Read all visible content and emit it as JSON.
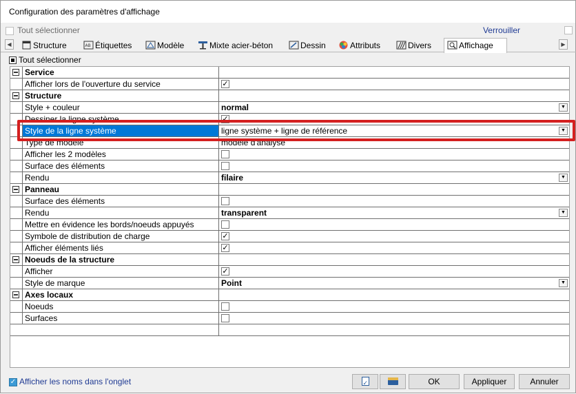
{
  "window": {
    "title": "Configuration des paramètres d'affichage"
  },
  "topbar": {
    "select_all": "Tout sélectionner",
    "lock": "Verrouiller"
  },
  "tabs": [
    {
      "label": "Structure",
      "icon": "structure-icon"
    },
    {
      "label": "Étiquettes",
      "icon": "labels-icon"
    },
    {
      "label": "Modèle",
      "icon": "model-icon"
    },
    {
      "label": "Mixte acier-béton",
      "icon": "composite-beam-icon"
    },
    {
      "label": "Dessin",
      "icon": "drawing-icon"
    },
    {
      "label": "Attributs",
      "icon": "attributes-icon"
    },
    {
      "label": "Divers",
      "icon": "misc-icon"
    },
    {
      "label": "Affichage",
      "icon": "display-icon"
    }
  ],
  "subbar": {
    "select_all": "Tout sélectionner"
  },
  "grid": {
    "rows": [
      {
        "type": "group",
        "label": "Service"
      },
      {
        "type": "check",
        "label": "Afficher lors de l'ouverture du service",
        "checked": true
      },
      {
        "type": "group",
        "label": "Structure"
      },
      {
        "type": "dropdown",
        "label": "Style + couleur",
        "value": "normal"
      },
      {
        "type": "check",
        "label": "Dessiner la ligne système",
        "checked": true
      },
      {
        "type": "dropdown",
        "label": "Style de la ligne système",
        "value": "ligne système + ligne de référence",
        "selected": true
      },
      {
        "type": "text",
        "label": "Type de modèle",
        "value": "modèle d'analyse"
      },
      {
        "type": "check",
        "label": "Afficher les 2 modèles",
        "checked": false
      },
      {
        "type": "check",
        "label": "Surface des éléments",
        "checked": false
      },
      {
        "type": "dropdown",
        "label": "Rendu",
        "value": "filaire"
      },
      {
        "type": "group",
        "label": "Panneau"
      },
      {
        "type": "check",
        "label": "Surface des éléments",
        "checked": false
      },
      {
        "type": "dropdown",
        "label": "Rendu",
        "value": "transparent"
      },
      {
        "type": "check",
        "label": "Mettre en évidence les bords/noeuds appuyés",
        "checked": false
      },
      {
        "type": "check",
        "label": "Symbole de distribution de charge",
        "checked": true
      },
      {
        "type": "check",
        "label": "Afficher éléments liés",
        "checked": true
      },
      {
        "type": "group",
        "label": "Noeuds de la structure"
      },
      {
        "type": "check",
        "label": "Afficher",
        "checked": true
      },
      {
        "type": "dropdown",
        "label": "Style de marque",
        "value": "Point"
      },
      {
        "type": "group",
        "label": "Axes locaux"
      },
      {
        "type": "check",
        "label": "Noeuds",
        "checked": false
      },
      {
        "type": "check",
        "label": "Surfaces",
        "checked": false
      }
    ]
  },
  "footer": {
    "show_names": "Afficher les noms dans l'onglet",
    "ok": "OK",
    "apply": "Appliquer",
    "cancel": "Annuler"
  },
  "colors": {
    "selection": "#0078d7",
    "highlight": "#d42020",
    "link_text": "#1f3a93"
  }
}
